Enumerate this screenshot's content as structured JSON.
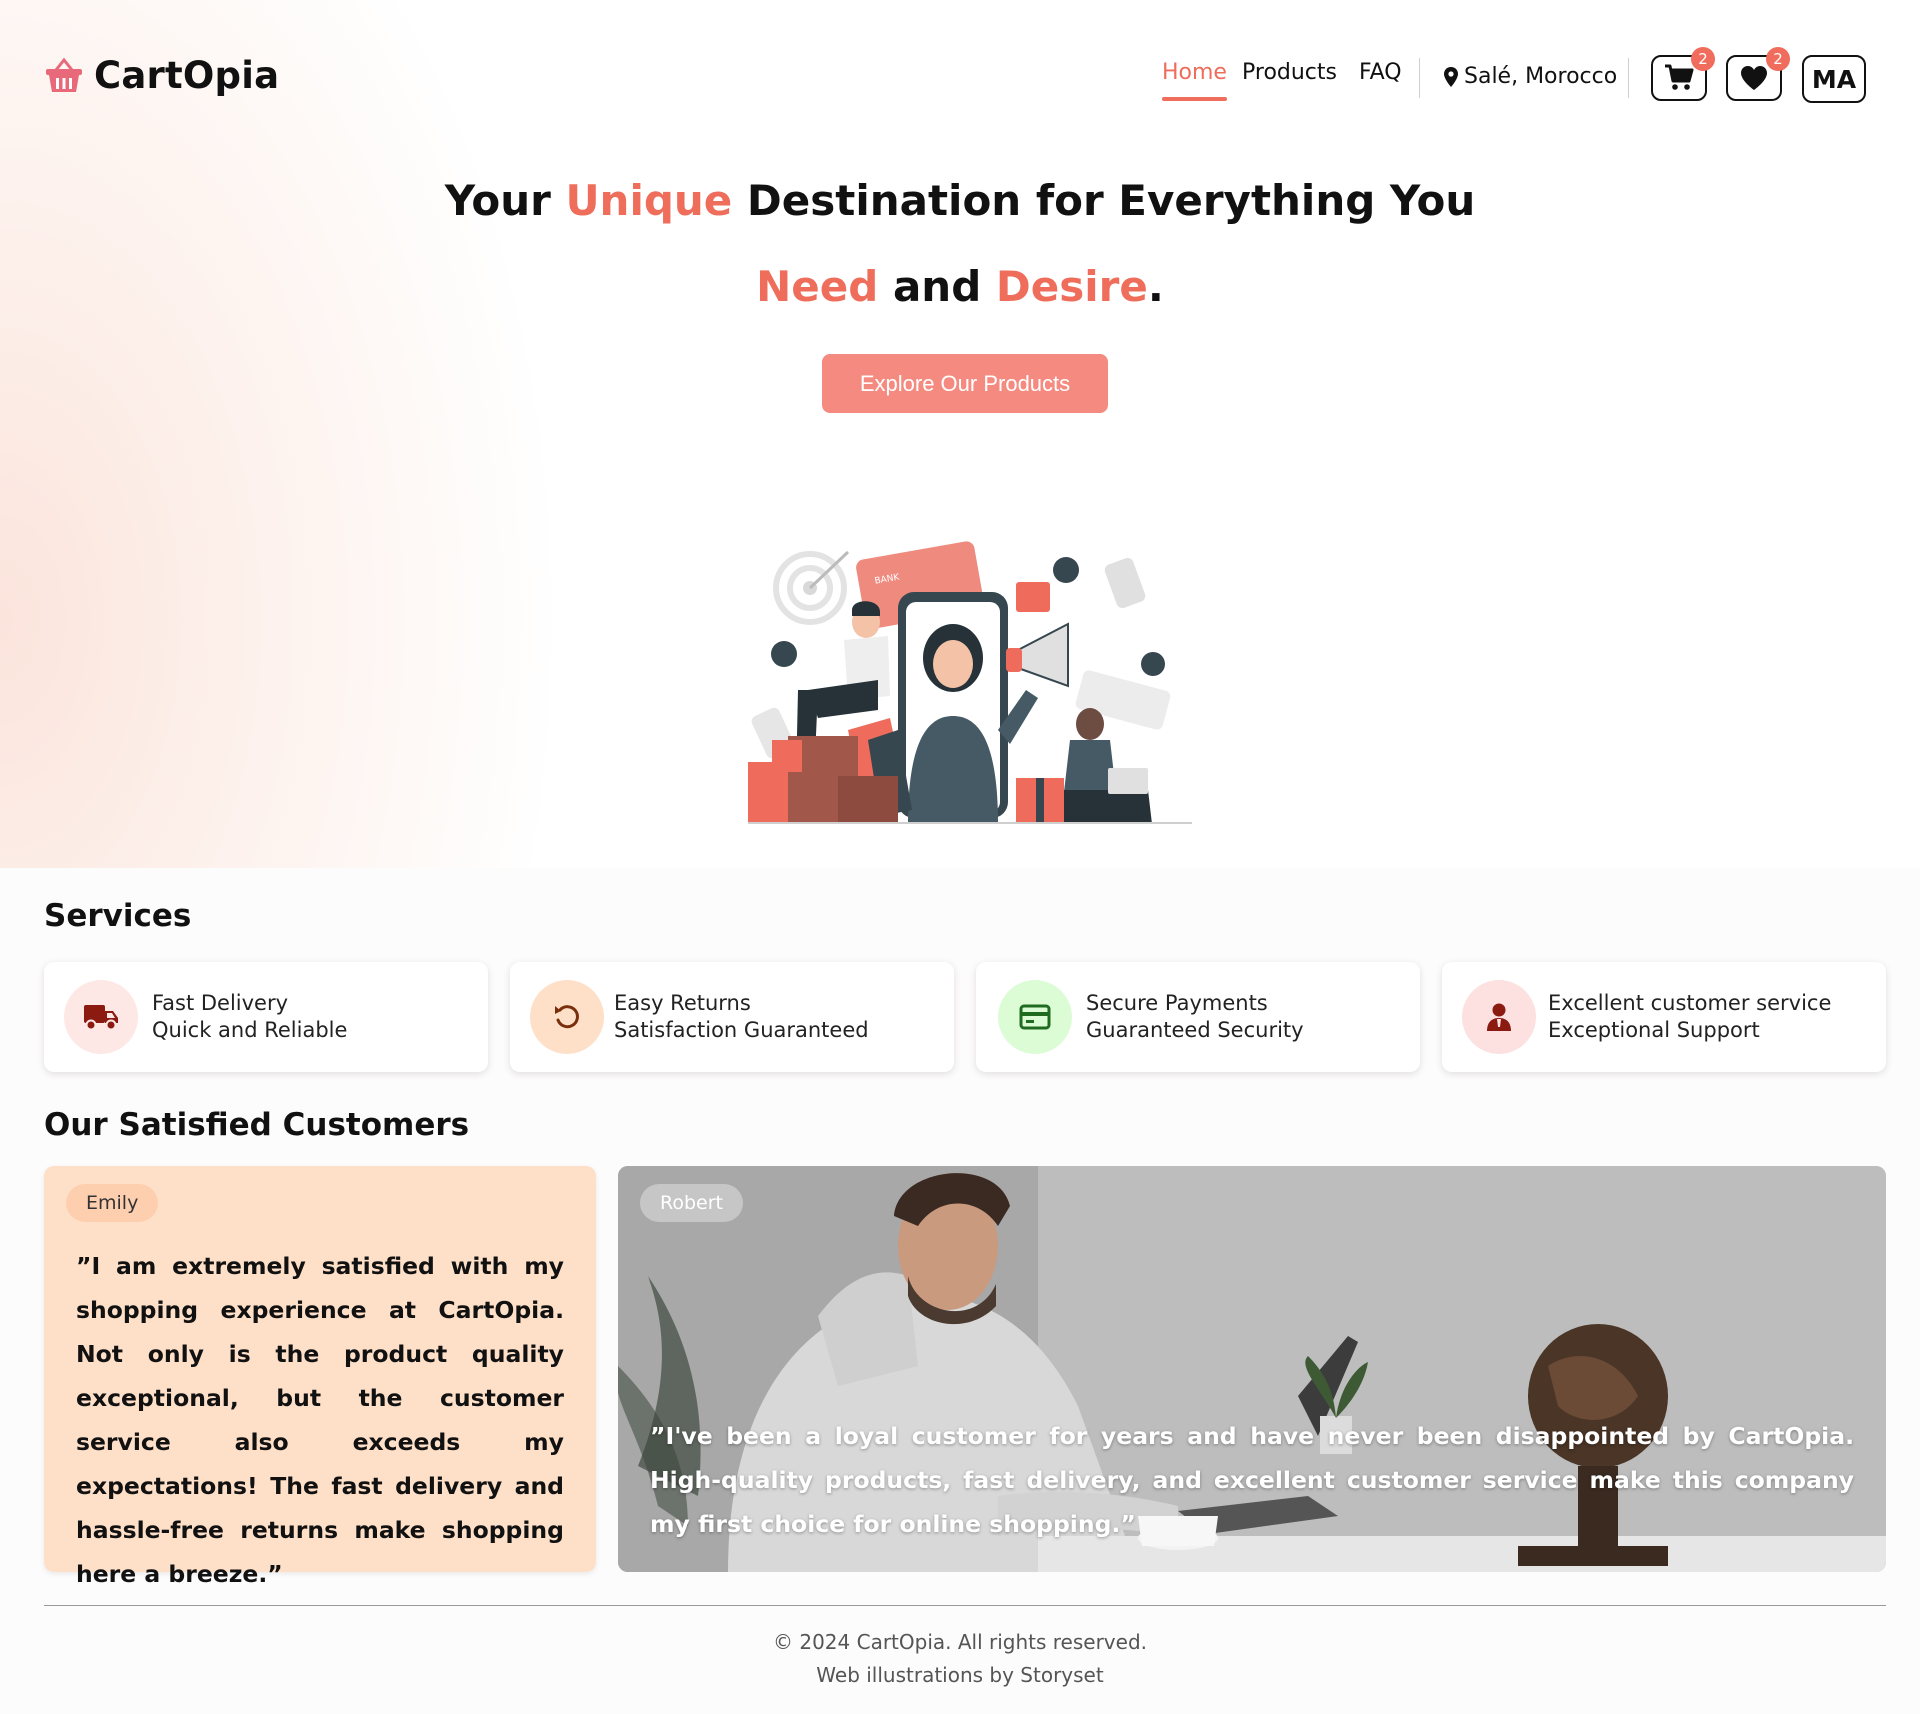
{
  "brand": {
    "name": "CartOpia",
    "accent": "#ee6e5b",
    "button_color": "#f58b80"
  },
  "nav": {
    "home": "Home",
    "products": "Products",
    "faq": "FAQ",
    "location": "Salé, Morocco",
    "cart_count": "2",
    "wishlist_count": "2",
    "language": "MA"
  },
  "hero": {
    "line1_a": "Your ",
    "line1_hl": "Unique",
    "line1_b": " Destination for Everything You",
    "line2_hl1": "Need",
    "line2_mid": " and ",
    "line2_hl2": "Desire",
    "line2_end": ".",
    "cta": "Explore Our Products"
  },
  "services": {
    "title": "Services",
    "items": [
      {
        "title": "Fast Delivery",
        "subtitle": "Quick and Reliable",
        "icon": "truck-icon",
        "bg": "#fde8e6",
        "fg": "#8b1a10"
      },
      {
        "title": "Easy Returns",
        "subtitle": "Satisfaction Guaranteed",
        "icon": "return-icon",
        "bg": "#fee0c9",
        "fg": "#7a2f0c"
      },
      {
        "title": "Secure Payments",
        "subtitle": "Guaranteed Security",
        "icon": "credit-card-icon",
        "bg": "#dcfcd6",
        "fg": "#1f6b1f"
      },
      {
        "title": "Excellent customer service",
        "subtitle": "Exceptional Support",
        "icon": "support-agent-icon",
        "bg": "#fde0e0",
        "fg": "#8b1a10"
      }
    ]
  },
  "testimonials": {
    "title": "Our Satisfied Customers",
    "items": [
      {
        "name": "Emily",
        "quote": "”I am extremely satisfied with my shopping experience at CartOpia. Not only is the product quality exceptional, but the customer service also exceeds my expectations! The fast delivery and hassle-free returns make shopping here a breeze.”"
      },
      {
        "name": "Robert",
        "quote": "”I've been a loyal customer for years and have never been disappointed by CartOpia. High-quality products, fast delivery, and excellent customer service make this company my first choice for online shopping.”"
      }
    ]
  },
  "footer": {
    "copyright": "© 2024 CartOpia. All rights reserved.",
    "credit": "Web illustrations by Storyset"
  }
}
